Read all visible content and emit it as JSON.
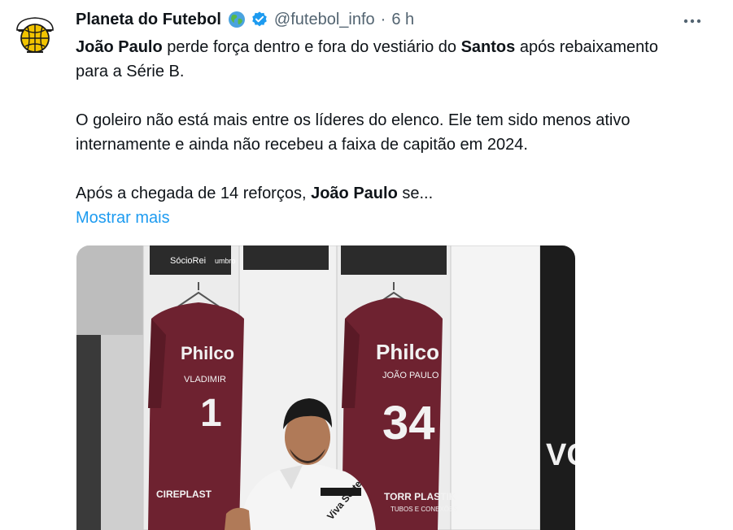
{
  "tweet": {
    "author_name": "Planeta do Futebol",
    "author_handle": "@futebol_info",
    "separator": "·",
    "time": "6 h",
    "icons": {
      "globe": "globe-emoji-icon",
      "verified": "verified-badge-icon",
      "more": "more-options-icon"
    },
    "colors": {
      "verified": "#1d9bf0",
      "link": "#1d9bf0",
      "muted": "#536471"
    },
    "text": {
      "p1": {
        "b1": "João Paulo",
        "t1": " perde força dentro e fora do vestiário do ",
        "b2": "Santos",
        "t2": " após rebaixamento para a Série B."
      },
      "p2": "O goleiro não está mais entre os líderes do elenco. Ele tem sido menos ativo internamente e ainda não recebeu a faixa de capitão em 2024.",
      "p3": {
        "t1": "Após a chegada de 14 reforços, ",
        "b1": "João Paulo",
        "t2": " se..."
      }
    },
    "show_more": "Mostrar mais",
    "media": {
      "shirt_left_sponsor": "Philco",
      "shirt_left_name": "VLADIMIR",
      "shirt_left_number": "1",
      "shirt_right_sponsor": "Philco",
      "shirt_right_name": "JOÃO PAULO",
      "shirt_right_number": "34",
      "banner_left": "SócioRei",
      "banner_right": "umbro",
      "sleeve_text": "Viva Sorte",
      "bottom_left": "CIREPLAST",
      "bottom_right": "TORR PLASTIK",
      "bottom_right_sub": "TUBOS E CONEXÕES",
      "side_text": "VCD"
    }
  }
}
